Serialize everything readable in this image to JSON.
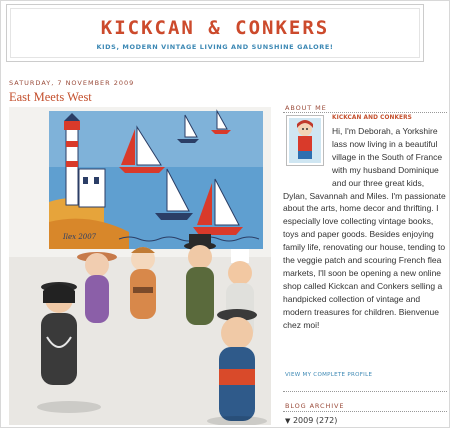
{
  "header": {
    "title": "KICKCAN & CONKERS",
    "description": "KIDS, MODERN VINTAGE LIVING AND SUNSHINE GALORE!"
  },
  "post": {
    "date": "SATURDAY, 7 NOVEMBER 2009",
    "title": "East Meets West",
    "image_signature": "Ilex 2007"
  },
  "sidebar": {
    "about_heading": "ABOUT ME",
    "profile_name": "KICKCAN AND CONKERS",
    "profile_text": "Hi, I'm Deborah, a Yorkshire lass now living in a beautiful village in the South of France with my husband Dominique and our three great kids, Dylan, Savannah and Miles. I'm passionate about the arts, home decor and thrifting. I especially love collecting vintage books, toys and paper goods. Besides enjoying family life, renovating our house, tending to the veggie patch and scouring French flea markets, I'll soon be opening a new online shop called Kickcan and Conkers selling a handpicked collection of vintage and modern treasures for children. Bienvenue chez moi!",
    "profile_link": "VIEW MY COMPLETE PROFILE",
    "archive_heading": "BLOG ARCHIVE",
    "archive": {
      "toggle": "▼",
      "year": "2009",
      "count": "(272)"
    }
  },
  "colors": {
    "title": "#cc4a2c",
    "link_blue": "#3c88b4",
    "heading_brown": "#9a4b3a"
  }
}
